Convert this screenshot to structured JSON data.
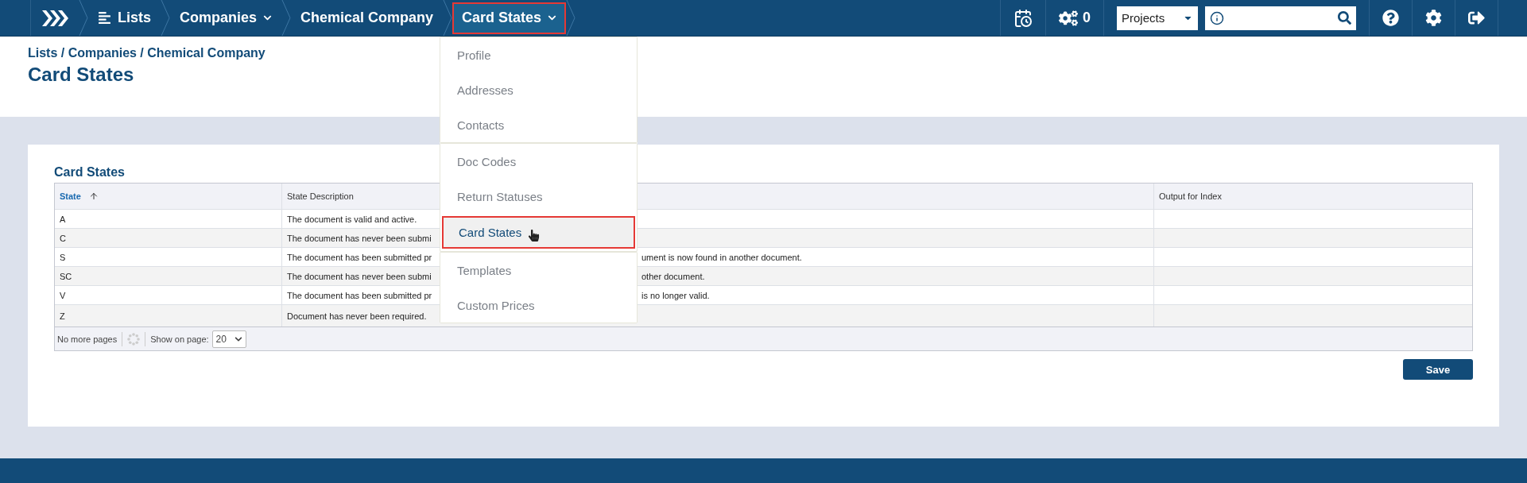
{
  "nav": {
    "items": [
      {
        "kind": "icon-link",
        "label": "Lists",
        "selected": false
      },
      {
        "kind": "dropdown",
        "label": "Companies",
        "selected": false
      },
      {
        "kind": "link",
        "label": "Chemical Company",
        "selected": false
      },
      {
        "kind": "dropdown",
        "label": "Card States",
        "selected": true
      }
    ]
  },
  "toolbar": {
    "tasks_count": "0",
    "project_select": "Projects"
  },
  "breadcrumb": "Lists / Companies / Chemical Company",
  "title": "Card States",
  "menu": {
    "groups": [
      [
        {
          "label": "Profile",
          "selected": false
        },
        {
          "label": "Addresses",
          "selected": false
        },
        {
          "label": "Contacts",
          "selected": false
        }
      ],
      [
        {
          "label": "Doc Codes",
          "selected": false
        },
        {
          "label": "Return Statuses",
          "selected": false
        },
        {
          "label": "Card States",
          "selected": true
        }
      ],
      [
        {
          "label": "Templates",
          "selected": false
        },
        {
          "label": "Custom Prices",
          "selected": false
        }
      ]
    ]
  },
  "table": {
    "title": "Card States",
    "columns": [
      {
        "label": "State",
        "sorted": true
      },
      {
        "label": "State Description",
        "sorted": false
      },
      {
        "label": "Output for Index",
        "sorted": false
      }
    ],
    "rows": [
      {
        "state": "A",
        "description": "The document is valid and active."
      },
      {
        "state": "C",
        "description": "The document has never been submi"
      },
      {
        "state": "S",
        "description": "The document has been submitted pr",
        "description_tail": "ument is now found in another document."
      },
      {
        "state": "SC",
        "description": "The document has never been submi",
        "description_tail": "other document."
      },
      {
        "state": "V",
        "description": "The document has been submitted pr",
        "description_tail": "is no longer valid."
      },
      {
        "state": "Z",
        "description": "Document has never been required."
      }
    ],
    "footer": {
      "paging": "No more pages",
      "page_size_label": "Show on page:",
      "page_size": "20"
    }
  },
  "save_button": "Save"
}
